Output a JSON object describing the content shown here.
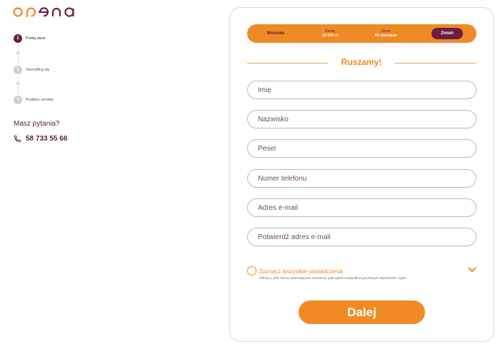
{
  "brand": {
    "logo_text": "opena",
    "accent": "#f08a24",
    "primary": "#6b1d46"
  },
  "steps": [
    {
      "number": "1",
      "label": "Podaj dane",
      "active": true
    },
    {
      "number": "2",
      "label": "Zweryfikuj się",
      "active": false
    },
    {
      "number": "3",
      "label": "Podpisz umowę",
      "active": false
    }
  ],
  "contact": {
    "question": "Masz pytania?",
    "phone": "58 733 55 66",
    "icon": "phone-icon"
  },
  "summary": {
    "wniosek": "Wniosek",
    "amount_label": "Kwota",
    "amount_value": "10 000 zł",
    "period_label": "Okres",
    "period_value": "44 miesiące",
    "change_label": "Zmień"
  },
  "form": {
    "heading": "Ruszamy!",
    "fields": {
      "first_name": "Imię",
      "last_name": "Nazwisko",
      "pesel": "Pesel",
      "phone": "Numer telefonu",
      "email": "Adres e-mail",
      "email_confirm": "Potwierdź adres e-mail"
    },
    "consent_title": "Zaznacz wszystkie oświadczenia",
    "consent_sub": "Kliknij tu, jeśli chcesz automatycznie zaznaczyć pola wyboru wszystkich poniższych oświadczeń i zgód.",
    "submit_label": "Dalej"
  }
}
